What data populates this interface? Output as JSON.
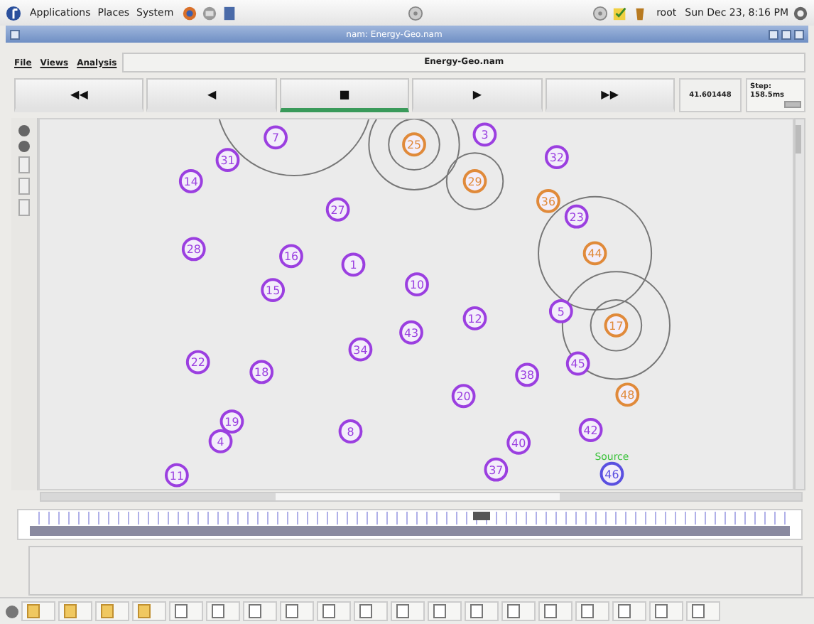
{
  "top_panel": {
    "menus": [
      "Applications",
      "Places",
      "System"
    ],
    "user": "root",
    "clock": "Sun Dec 23,  8:16 PM"
  },
  "window": {
    "title": "nam: Energy-Geo.nam"
  },
  "menu": [
    "File",
    "Views",
    "Analysis"
  ],
  "file_name": "Energy-Geo.nam",
  "controls": [
    {
      "label": "◀◀",
      "selected": false
    },
    {
      "label": "◀",
      "selected": false
    },
    {
      "label": "■",
      "selected": true
    },
    {
      "label": "▶",
      "selected": false
    },
    {
      "label": "▶▶",
      "selected": false
    }
  ],
  "time": "41.601448",
  "step": "Step: 158.5ms",
  "nodes": [
    {
      "label": "7",
      "color": "#9b3fe0"
    },
    {
      "label": "25",
      "color": "#e08a3a"
    },
    {
      "label": "3",
      "color": "#9b3fe0"
    },
    {
      "label": "31",
      "color": "#9b3fe0"
    },
    {
      "label": "14",
      "color": "#9b3fe0"
    },
    {
      "label": "32",
      "color": "#9b3fe0"
    },
    {
      "label": "29",
      "color": "#e08a3a"
    },
    {
      "label": "36",
      "color": "#e08a3a"
    },
    {
      "label": "27",
      "color": "#9b3fe0"
    },
    {
      "label": "23",
      "color": "#9b3fe0"
    },
    {
      "label": "28",
      "color": "#9b3fe0"
    },
    {
      "label": "16",
      "color": "#9b3fe0"
    },
    {
      "label": "1",
      "color": "#9b3fe0"
    },
    {
      "label": "44",
      "color": "#e08a3a"
    },
    {
      "label": "15",
      "color": "#9b3fe0"
    },
    {
      "label": "10",
      "color": "#9b3fe0"
    },
    {
      "label": "5",
      "color": "#9b3fe0"
    },
    {
      "label": "12",
      "color": "#9b3fe0"
    },
    {
      "label": "17",
      "color": "#e08a3a"
    },
    {
      "label": "43",
      "color": "#9b3fe0"
    },
    {
      "label": "34",
      "color": "#9b3fe0"
    },
    {
      "label": "22",
      "color": "#9b3fe0"
    },
    {
      "label": "18",
      "color": "#9b3fe0"
    },
    {
      "label": "45",
      "color": "#9b3fe0"
    },
    {
      "label": "38",
      "color": "#9b3fe0"
    },
    {
      "label": "20",
      "color": "#9b3fe0"
    },
    {
      "label": "48",
      "color": "#e08a3a"
    },
    {
      "label": "19",
      "color": "#9b3fe0"
    },
    {
      "label": "4",
      "color": "#9b3fe0"
    },
    {
      "label": "8",
      "color": "#9b3fe0"
    },
    {
      "label": "40",
      "color": "#9b3fe0"
    },
    {
      "label": "42",
      "color": "#9b3fe0"
    },
    {
      "label": "37",
      "color": "#9b3fe0"
    },
    {
      "label": "11",
      "color": "#9b3fe0"
    },
    {
      "label": "46",
      "color": "#5a50e0"
    }
  ],
  "source_label": "Source"
}
